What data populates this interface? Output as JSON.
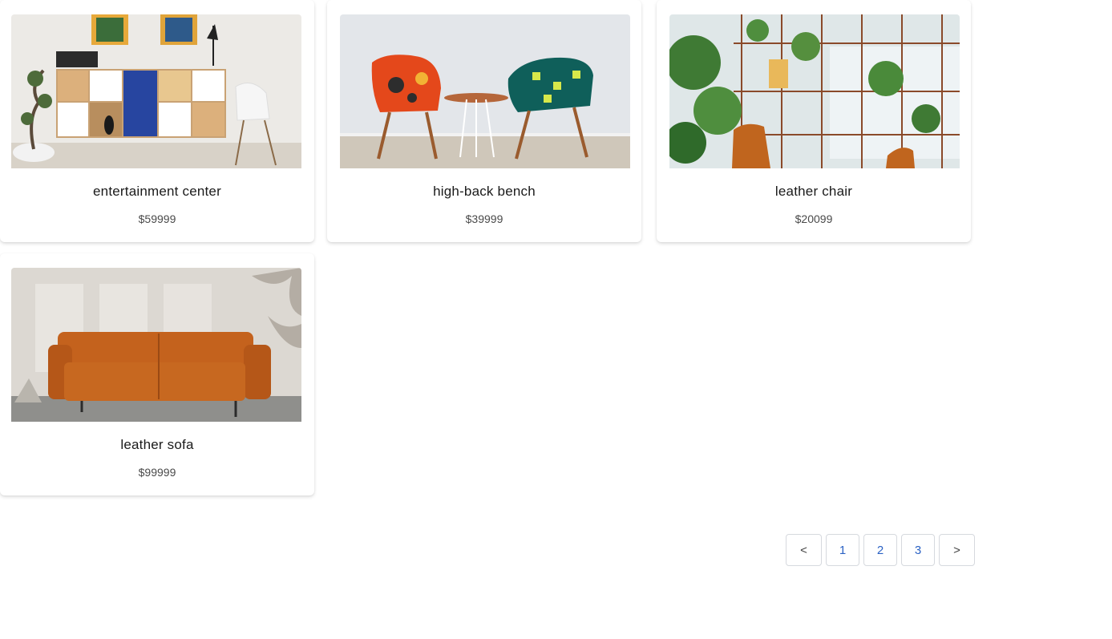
{
  "products": [
    {
      "name": "entertainment center",
      "price": "$59999",
      "image": "living-room-shelving"
    },
    {
      "name": "high-back bench",
      "price": "$39999",
      "image": "patterned-chairs"
    },
    {
      "name": "leather chair",
      "price": "$20099",
      "image": "plant-shelf-chair"
    },
    {
      "name": "leather sofa",
      "price": "$99999",
      "image": "orange-leather-sofa"
    }
  ],
  "pagination": {
    "prev": "<",
    "pages": [
      "1",
      "2",
      "3"
    ],
    "next": ">"
  },
  "colors": {
    "link": "#2b62c4",
    "border": "#d6d9de"
  }
}
